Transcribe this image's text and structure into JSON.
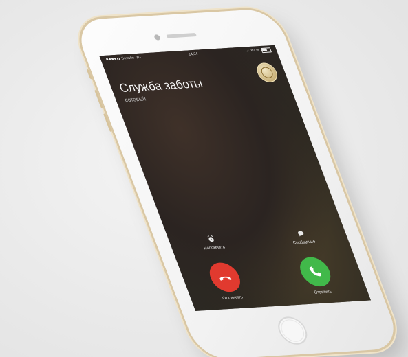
{
  "statusbar": {
    "carrier": "Билайн",
    "network": "3G",
    "time": "14:34",
    "battery_pct": "87 %"
  },
  "call": {
    "caller_name": "Служба заботы",
    "caller_type": "сотовый"
  },
  "actions": {
    "remind_label": "Напомнить",
    "message_label": "Сообщение",
    "decline_label": "Отклонить",
    "answer_label": "Ответить"
  },
  "colors": {
    "decline": "#e13a2f",
    "answer": "#41b94a",
    "frame_gold": "#d9c7a4"
  }
}
